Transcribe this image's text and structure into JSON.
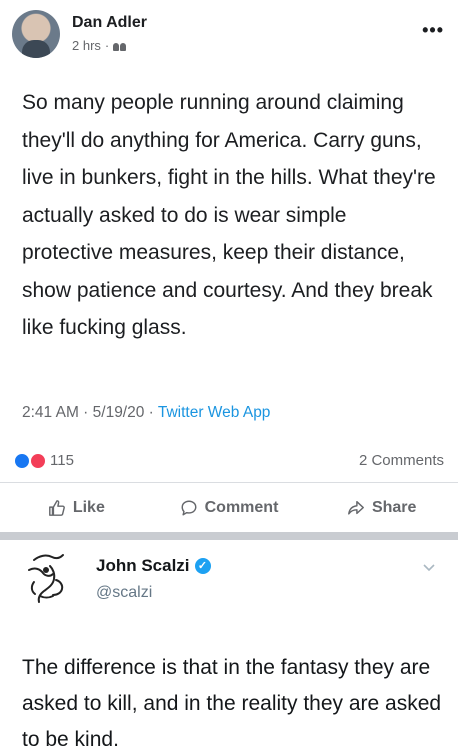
{
  "post": {
    "author": "Dan Adler",
    "time": "2 hrs",
    "separator": "·",
    "audience_icon": "friends-icon",
    "more_label": "•••",
    "text": "So many people running around claiming they'll do anything for America. Carry guns, live in bunkers, fight in the hills. What they're actually asked to do is wear simple protective measures, keep their distance, show patience and courtesy. And they break like fucking glass.",
    "tweet_time": "2:41 AM · 5/19/20 · ",
    "tweet_source": "Twitter Web App"
  },
  "reactions": {
    "count": "115",
    "icons": [
      "like-reaction-icon",
      "love-reaction-icon"
    ],
    "like_color": "#1877f2",
    "love_color": "#f33e58"
  },
  "comments": {
    "label": "2 Comments"
  },
  "actions": {
    "like": "Like",
    "comment": "Comment",
    "share": "Share"
  },
  "tweet": {
    "name": "John Scalzi",
    "verified_mark": "✓",
    "handle": "@scalzi",
    "text": "The difference is that in the fantasy they are asked to kill, and in the reality they are asked to be kind.",
    "verified_color": "#1da1f2"
  }
}
